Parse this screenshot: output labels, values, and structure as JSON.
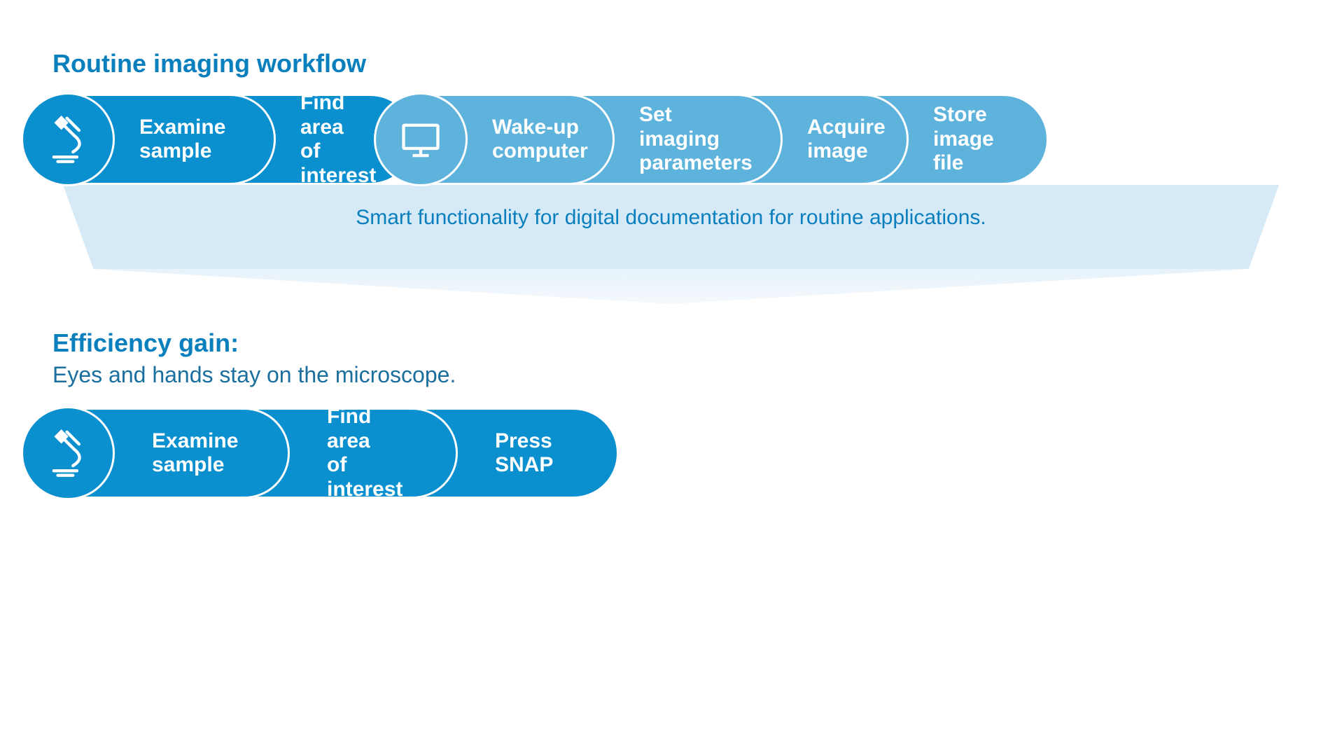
{
  "routine": {
    "title": "Routine imaging workflow",
    "steps": {
      "s1": "Examine\nsample",
      "s2": "Find area\nof interest",
      "s3": "Wake-up\ncomputer",
      "s4": "Set imaging\nparameters",
      "s5": "Acquire\nimage",
      "s6": "Store\nimage file"
    },
    "caption": "Smart functionality for digital documentation for routine applications."
  },
  "efficiency": {
    "title": "Efficiency gain:",
    "desc": "Eyes and hands stay on the microscope.",
    "steps": {
      "s1": "Examine\nsample",
      "s2": "Find area\nof interest",
      "s3": "Press\nSNAP"
    }
  },
  "icons": {
    "microscope": "microscope-icon",
    "monitor": "monitor-icon"
  },
  "colors": {
    "dark": "#0a8fcf",
    "light": "#5eb3dd",
    "title": "#0a7fbd",
    "caption_bg": "#d6e9f7"
  }
}
